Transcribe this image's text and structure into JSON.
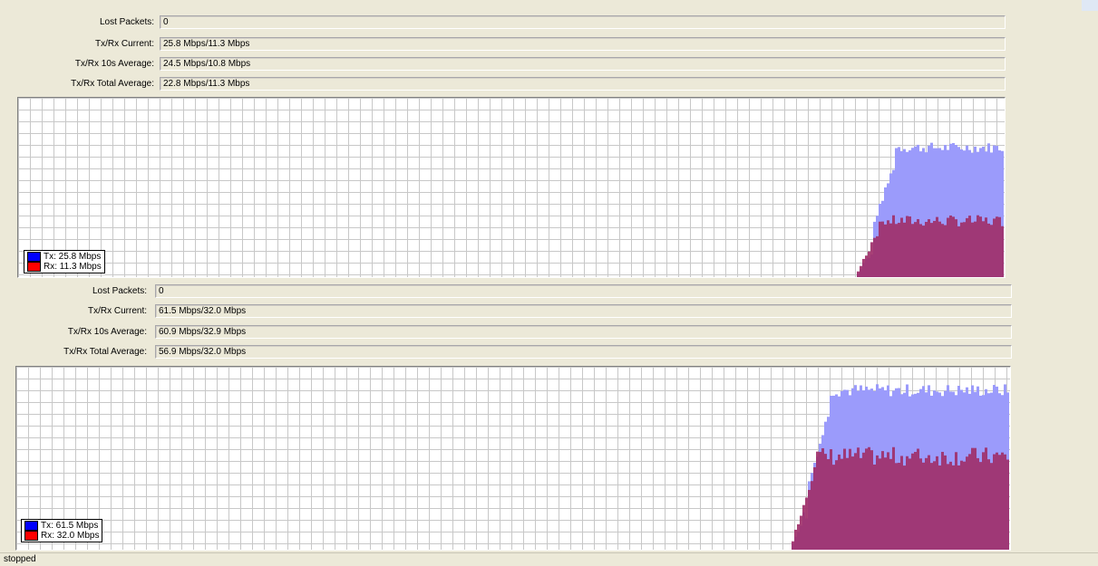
{
  "colors": {
    "tx": "#0000ff",
    "rx": "#ff0000",
    "tx_fill": "#9b9bfb",
    "rx_fill": "#a0306a",
    "grid": "#c8c8c8"
  },
  "top": {
    "rows": [
      {
        "label": "Lost Packets:",
        "value": "0"
      },
      {
        "label": "Tx/Rx Current:",
        "value": "25.8 Mbps/11.3 Mbps"
      },
      {
        "label": "Tx/Rx 10s Average:",
        "value": "24.5 Mbps/10.8 Mbps"
      },
      {
        "label": "Tx/Rx Total Average:",
        "value": "22.8 Mbps/11.3 Mbps"
      }
    ],
    "legend": {
      "tx": "Tx:  25.8 Mbps",
      "rx": "Rx:  11.3 Mbps"
    },
    "chart_data": {
      "type": "area",
      "series": [
        {
          "name": "Tx",
          "start_fraction": 0.85,
          "level_fraction": 0.73
        },
        {
          "name": "Rx",
          "start_fraction": 0.85,
          "level_fraction": 0.32
        }
      ]
    }
  },
  "bottom": {
    "rows": [
      {
        "label": "Lost Packets:",
        "value": "0"
      },
      {
        "label": "Tx/Rx Current:",
        "value": "61.5 Mbps/32.0 Mbps"
      },
      {
        "label": "Tx/Rx 10s Average:",
        "value": "60.9 Mbps/32.9 Mbps"
      },
      {
        "label": "Tx/Rx Total Average:",
        "value": "56.9 Mbps/32.0 Mbps"
      }
    ],
    "legend": {
      "tx": "Tx:  61.5 Mbps",
      "rx": "Rx:  32.0 Mbps"
    },
    "chart_data": {
      "type": "area",
      "series": [
        {
          "name": "Tx",
          "start_fraction": 0.78,
          "level_fraction": 0.88
        },
        {
          "name": "Rx",
          "start_fraction": 0.78,
          "level_fraction": 0.52
        }
      ]
    }
  },
  "status": {
    "text": "stopped"
  }
}
